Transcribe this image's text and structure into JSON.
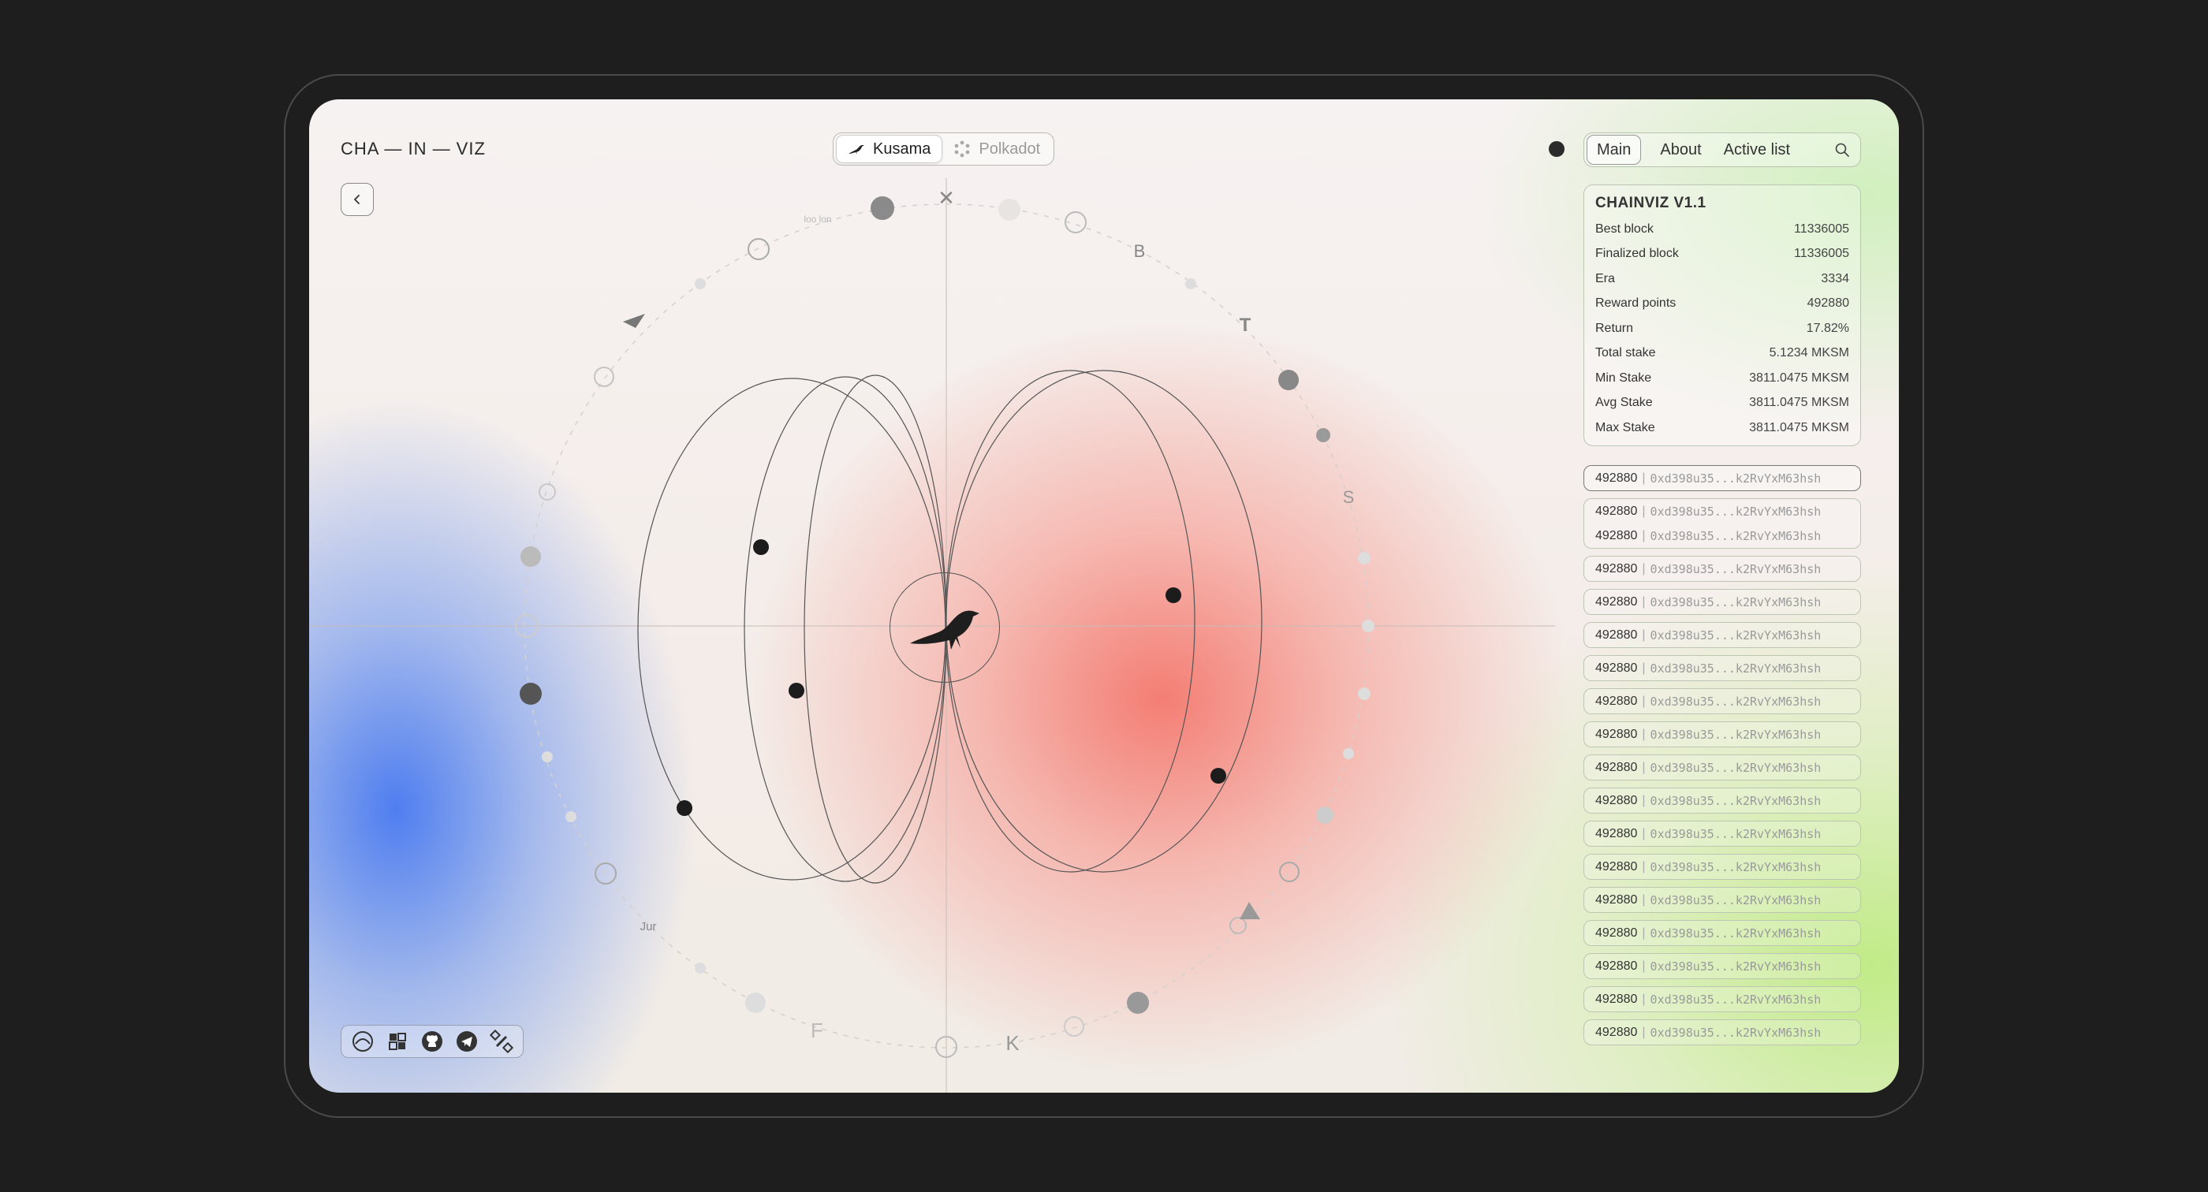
{
  "app": {
    "logo": "CHA — IN — VIZ"
  },
  "network_switch": {
    "tabs": [
      {
        "label": "Kusama",
        "icon": "kusama-bird-icon",
        "active": true
      },
      {
        "label": "Polkadot",
        "icon": "polkadot-icon",
        "active": false
      }
    ]
  },
  "nav": {
    "tabs": [
      {
        "label": "Main",
        "active": true
      },
      {
        "label": "About",
        "active": false
      },
      {
        "label": "Active list",
        "active": false
      }
    ]
  },
  "stats": {
    "title": "CHAINVIZ V1.1",
    "rows": [
      {
        "label": "Best block",
        "value": "11336005"
      },
      {
        "label": "Finalized block",
        "value": "11336005"
      },
      {
        "label": "Era",
        "value": "3334"
      },
      {
        "label": "Reward points",
        "value": "492880"
      },
      {
        "label": "Return",
        "value": "17.82%"
      },
      {
        "label": "Total stake",
        "value": "5.1234 MKSM"
      },
      {
        "label": "Min Stake",
        "value": "3811.0475 MKSM"
      },
      {
        "label": "Avg Stake",
        "value": "3811.0475 MKSM"
      },
      {
        "label": "Max Stake",
        "value": "3811.0475 MKSM"
      }
    ]
  },
  "validators": [
    {
      "lines": [
        {
          "points": "492880",
          "address": "0xd398u35...k2RvYxM63hsh"
        }
      ],
      "selected": true
    },
    {
      "lines": [
        {
          "points": "492880",
          "address": "0xd398u35...k2RvYxM63hsh"
        },
        {
          "points": "492880",
          "address": "0xd398u35...k2RvYxM63hsh"
        }
      ],
      "selected": false
    },
    {
      "lines": [
        {
          "points": "492880",
          "address": "0xd398u35...k2RvYxM63hsh"
        }
      ],
      "selected": false
    },
    {
      "lines": [
        {
          "points": "492880",
          "address": "0xd398u35...k2RvYxM63hsh"
        }
      ],
      "selected": false
    },
    {
      "lines": [
        {
          "points": "492880",
          "address": "0xd398u35...k2RvYxM63hsh"
        }
      ],
      "selected": false
    },
    {
      "lines": [
        {
          "points": "492880",
          "address": "0xd398u35...k2RvYxM63hsh"
        }
      ],
      "selected": false
    },
    {
      "lines": [
        {
          "points": "492880",
          "address": "0xd398u35...k2RvYxM63hsh"
        }
      ],
      "selected": false
    },
    {
      "lines": [
        {
          "points": "492880",
          "address": "0xd398u35...k2RvYxM63hsh"
        }
      ],
      "selected": false
    },
    {
      "lines": [
        {
          "points": "492880",
          "address": "0xd398u35...k2RvYxM63hsh"
        }
      ],
      "selected": false
    },
    {
      "lines": [
        {
          "points": "492880",
          "address": "0xd398u35...k2RvYxM63hsh"
        }
      ],
      "selected": false
    },
    {
      "lines": [
        {
          "points": "492880",
          "address": "0xd398u35...k2RvYxM63hsh"
        }
      ],
      "selected": false
    },
    {
      "lines": [
        {
          "points": "492880",
          "address": "0xd398u35...k2RvYxM63hsh"
        }
      ],
      "selected": false
    },
    {
      "lines": [
        {
          "points": "492880",
          "address": "0xd398u35...k2RvYxM63hsh"
        }
      ],
      "selected": false
    },
    {
      "lines": [
        {
          "points": "492880",
          "address": "0xd398u35...k2RvYxM63hsh"
        }
      ],
      "selected": false
    },
    {
      "lines": [
        {
          "points": "492880",
          "address": "0xd398u35...k2RvYxM63hsh"
        }
      ],
      "selected": false
    },
    {
      "lines": [
        {
          "points": "492880",
          "address": "0xd398u35...k2RvYxM63hsh"
        }
      ],
      "selected": false
    },
    {
      "lines": [
        {
          "points": "492880",
          "address": "0xd398u35...k2RvYxM63hsh"
        }
      ],
      "selected": false
    }
  ],
  "ring_labels": {
    "x": "✕",
    "b": "B",
    "t": "T",
    "s": "S",
    "f": "F",
    "k": "K",
    "jur": "Jur",
    "ioo": "loo lon"
  },
  "social": [
    {
      "icon": "element-icon"
    },
    {
      "icon": "polkassembly-icon"
    },
    {
      "icon": "github-icon"
    },
    {
      "icon": "telegram-icon"
    },
    {
      "icon": "satellite-icon"
    }
  ]
}
